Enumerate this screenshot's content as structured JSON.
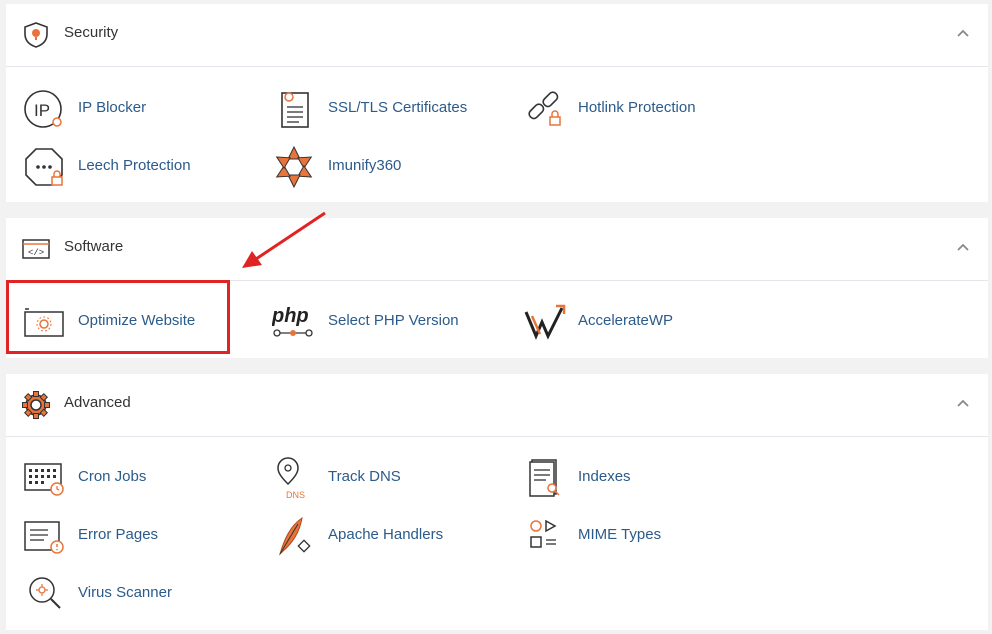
{
  "sections": [
    {
      "title": "Security",
      "icon": "shield-icon",
      "items": [
        {
          "label": "IP Blocker",
          "icon": "ip-blocker-icon"
        },
        {
          "label": "SSL/TLS Certificates",
          "icon": "certificate-icon"
        },
        {
          "label": "Hotlink Protection",
          "icon": "hotlink-icon"
        },
        {
          "label": "Leech Protection",
          "icon": "leech-icon"
        },
        {
          "label": "Imunify360",
          "icon": "imunify-icon"
        }
      ]
    },
    {
      "title": "Software",
      "icon": "code-window-icon",
      "items": [
        {
          "label": "Optimize Website",
          "icon": "optimize-icon"
        },
        {
          "label": "Select PHP Version",
          "icon": "php-icon"
        },
        {
          "label": "AccelerateWP",
          "icon": "acceleratewp-icon"
        }
      ]
    },
    {
      "title": "Advanced",
      "icon": "gear-icon",
      "items": [
        {
          "label": "Cron Jobs",
          "icon": "cron-icon"
        },
        {
          "label": "Track DNS",
          "icon": "dns-icon"
        },
        {
          "label": "Indexes",
          "icon": "indexes-icon"
        },
        {
          "label": "Error Pages",
          "icon": "error-pages-icon"
        },
        {
          "label": "Apache Handlers",
          "icon": "feather-icon"
        },
        {
          "label": "MIME Types",
          "icon": "mime-icon"
        },
        {
          "label": "Virus Scanner",
          "icon": "virus-icon"
        }
      ]
    }
  ],
  "php_logo_text": "php",
  "dns_badge_text": "DNS",
  "colors": {
    "accent_orange": "#e8743b",
    "link_blue": "#2b5b8a",
    "highlight_red": "#e02424"
  }
}
